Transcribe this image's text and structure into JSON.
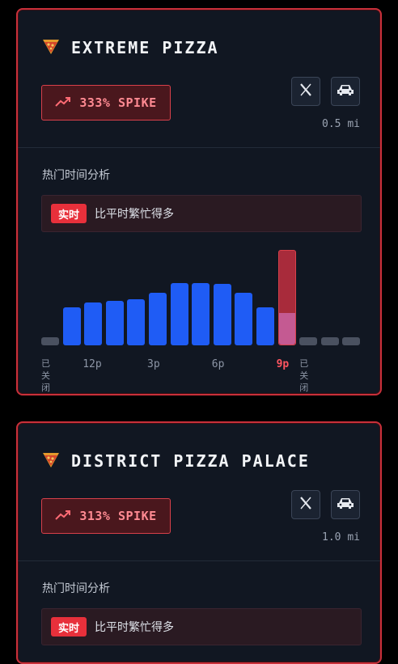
{
  "colors": {
    "accent": "#e8303b",
    "bar_blue": "#1f5cf5",
    "bar_closed": "#4a5160",
    "bar_spike": "#a82b3b",
    "bar_spike_inner": "#c45a92"
  },
  "cards": [
    {
      "title": "EXTREME PIZZA",
      "icon": "pizza-slice-icon",
      "spike_label": "333% SPIKE",
      "distance": "0.5 mi",
      "section_title": "热门时间分析",
      "live_badge": "实时",
      "live_text": "比平时繁忙得多",
      "bars": [
        {
          "value": 0.0,
          "state": "closed"
        },
        {
          "value": 0.4,
          "state": "open"
        },
        {
          "value": 0.45,
          "state": "open"
        },
        {
          "value": 0.47,
          "state": "open"
        },
        {
          "value": 0.48,
          "state": "open"
        },
        {
          "value": 0.55,
          "state": "open"
        },
        {
          "value": 0.65,
          "state": "open"
        },
        {
          "value": 0.65,
          "state": "open"
        },
        {
          "value": 0.64,
          "state": "open"
        },
        {
          "value": 0.55,
          "state": "open"
        },
        {
          "value": 0.4,
          "state": "open"
        },
        {
          "value": 1.0,
          "usual": 0.33,
          "state": "now"
        },
        {
          "value": 0.0,
          "state": "closed"
        },
        {
          "value": 0.0,
          "state": "closed"
        },
        {
          "value": 0.0,
          "state": "closed"
        }
      ],
      "ticks": [
        {
          "label": "已关闭",
          "bar": 0,
          "style": "small"
        },
        {
          "label": "12p",
          "bar": 2,
          "style": "normal"
        },
        {
          "label": "3p",
          "bar": 5,
          "style": "normal"
        },
        {
          "label": "6p",
          "bar": 8,
          "style": "normal"
        },
        {
          "label": "9p",
          "bar": 11,
          "style": "active"
        },
        {
          "label": "已关闭",
          "bar": 12,
          "style": "small"
        }
      ]
    },
    {
      "title": "DISTRICT PIZZA PALACE",
      "icon": "pizza-slice-icon",
      "spike_label": "313% SPIKE",
      "distance": "1.0 mi",
      "section_title": "热门时间分析",
      "live_badge": "实时",
      "live_text": "比平时繁忙得多"
    }
  ]
}
